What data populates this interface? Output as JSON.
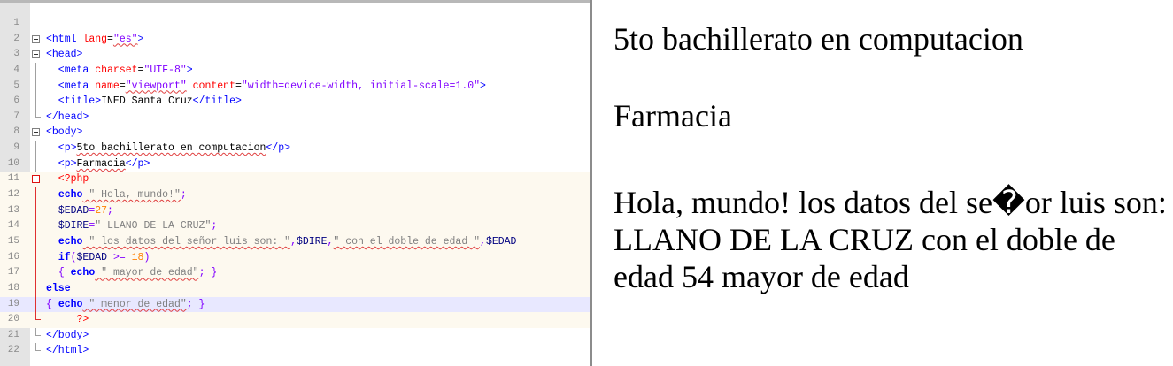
{
  "editor": {
    "lines": [
      {
        "num": "1",
        "fold": "",
        "segments": []
      },
      {
        "num": "2",
        "fold": "box",
        "segments": [
          {
            "t": "<html ",
            "c": "tag"
          },
          {
            "t": "lang",
            "c": "attr"
          },
          {
            "t": "=",
            "c": "plain"
          },
          {
            "t": "\"es\"",
            "c": "val"
          },
          {
            "t": ">",
            "c": "tag"
          }
        ]
      },
      {
        "num": "3",
        "fold": "box",
        "segments": [
          {
            "t": "<head>",
            "c": "tag"
          }
        ]
      },
      {
        "num": "4",
        "fold": "line",
        "segments": [
          {
            "t": "  <meta ",
            "c": "tag"
          },
          {
            "t": "charset",
            "c": "attr"
          },
          {
            "t": "=",
            "c": "plain"
          },
          {
            "t": "\"UTF-8\"",
            "c": "val"
          },
          {
            "t": ">",
            "c": "tag"
          }
        ]
      },
      {
        "num": "5",
        "fold": "line",
        "segments": [
          {
            "t": "  <meta ",
            "c": "tag"
          },
          {
            "t": "name",
            "c": "attr"
          },
          {
            "t": "=",
            "c": "plain"
          },
          {
            "t": "\"viewport\"",
            "c": "val"
          },
          {
            "t": " ",
            "c": "plain"
          },
          {
            "t": "content",
            "c": "attr"
          },
          {
            "t": "=",
            "c": "plain"
          },
          {
            "t": "\"width=device-width, initial-scale=1.0\"",
            "c": "val"
          },
          {
            "t": ">",
            "c": "tag"
          }
        ]
      },
      {
        "num": "6",
        "fold": "line",
        "segments": [
          {
            "t": "  <title>",
            "c": "tag"
          },
          {
            "t": "INED Santa Cruz",
            "c": "plain"
          },
          {
            "t": "</title>",
            "c": "tag"
          }
        ]
      },
      {
        "num": "7",
        "fold": "end",
        "segments": [
          {
            "t": "</head>",
            "c": "tag"
          }
        ]
      },
      {
        "num": "8",
        "fold": "box",
        "segments": [
          {
            "t": "<body>",
            "c": "tag"
          }
        ]
      },
      {
        "num": "9",
        "fold": "line",
        "segments": [
          {
            "t": "  <p>",
            "c": "tag"
          },
          {
            "t": "5to bachillerato en computacion",
            "c": "plain"
          },
          {
            "t": "</p>",
            "c": "tag"
          }
        ]
      },
      {
        "num": "10",
        "fold": "line",
        "segments": [
          {
            "t": "  <p>",
            "c": "tag"
          },
          {
            "t": "Farmacia",
            "c": "plain"
          },
          {
            "t": "</p>",
            "c": "tag"
          }
        ]
      },
      {
        "num": "11",
        "fold": "boxred",
        "segments": [
          {
            "t": "  <?php",
            "c": "phptag"
          }
        ]
      },
      {
        "num": "12",
        "fold": "red",
        "segments": [
          {
            "t": "  ",
            "c": "plain"
          },
          {
            "t": "echo",
            "c": "kw"
          },
          {
            "t": " \" Hola, mundo!\"",
            "c": "str"
          },
          {
            "t": ";",
            "c": "op"
          }
        ]
      },
      {
        "num": "13",
        "fold": "red",
        "segments": [
          {
            "t": "  ",
            "c": "plain"
          },
          {
            "t": "$EDAD",
            "c": "var"
          },
          {
            "t": "=",
            "c": "op"
          },
          {
            "t": "27",
            "c": "num"
          },
          {
            "t": ";",
            "c": "op"
          }
        ]
      },
      {
        "num": "14",
        "fold": "red",
        "segments": [
          {
            "t": "  ",
            "c": "plain"
          },
          {
            "t": "$DIRE",
            "c": "var"
          },
          {
            "t": "=",
            "c": "op"
          },
          {
            "t": "\" LLANO DE LA CRUZ\"",
            "c": "str"
          },
          {
            "t": ";",
            "c": "op"
          }
        ]
      },
      {
        "num": "15",
        "fold": "red",
        "segments": [
          {
            "t": "  ",
            "c": "plain"
          },
          {
            "t": "echo",
            "c": "kw"
          },
          {
            "t": " \" los datos del señor luis son: \"",
            "c": "str"
          },
          {
            "t": ",",
            "c": "op"
          },
          {
            "t": "$DIRE",
            "c": "var"
          },
          {
            "t": ",",
            "c": "op"
          },
          {
            "t": "\" con el doble de edad \"",
            "c": "str"
          },
          {
            "t": ",",
            "c": "op"
          },
          {
            "t": "$EDAD",
            "c": "var"
          }
        ]
      },
      {
        "num": "16",
        "fold": "red",
        "segments": [
          {
            "t": "  ",
            "c": "plain"
          },
          {
            "t": "if",
            "c": "kw"
          },
          {
            "t": "(",
            "c": "op"
          },
          {
            "t": "$EDAD",
            "c": "var"
          },
          {
            "t": " >= ",
            "c": "op"
          },
          {
            "t": "18",
            "c": "num"
          },
          {
            "t": ")",
            "c": "op"
          }
        ]
      },
      {
        "num": "17",
        "fold": "red",
        "segments": [
          {
            "t": "  ",
            "c": "plain"
          },
          {
            "t": "{ ",
            "c": "op"
          },
          {
            "t": "echo",
            "c": "kw"
          },
          {
            "t": " \" mayor de edad\"",
            "c": "str"
          },
          {
            "t": "; }",
            "c": "op"
          }
        ]
      },
      {
        "num": "18",
        "fold": "red",
        "segments": [
          {
            "t": "else",
            "c": "kw"
          }
        ]
      },
      {
        "num": "19",
        "fold": "red",
        "segments": [
          {
            "t": "{ ",
            "c": "op"
          },
          {
            "t": "echo",
            "c": "kw"
          },
          {
            "t": " \" menor de edad\"",
            "c": "str"
          },
          {
            "t": "; }",
            "c": "op"
          }
        ]
      },
      {
        "num": "20",
        "fold": "endred",
        "segments": [
          {
            "t": "     ?>",
            "c": "phptag"
          }
        ]
      },
      {
        "num": "21",
        "fold": "end",
        "segments": [
          {
            "t": "</body>",
            "c": "tag"
          }
        ]
      },
      {
        "num": "22",
        "fold": "end",
        "segments": [
          {
            "t": "</html>",
            "c": "tag"
          }
        ]
      }
    ],
    "colors": {
      "gutter": "#e4e4e4",
      "php_background": "#fdf9ef",
      "current_line": "#e8e8ff",
      "tag": "#0000ff",
      "attribute": "#ff0000",
      "attribute_value": "#8000ff",
      "string": "#808080",
      "number": "#ff8000"
    }
  },
  "output": {
    "paragraphs": [
      "5to bachillerato en computacion",
      "Farmacia",
      "Hola, mundo! los datos del se�or luis son: LLANO DE LA CRUZ con el doble de edad 54 mayor de edad"
    ]
  }
}
